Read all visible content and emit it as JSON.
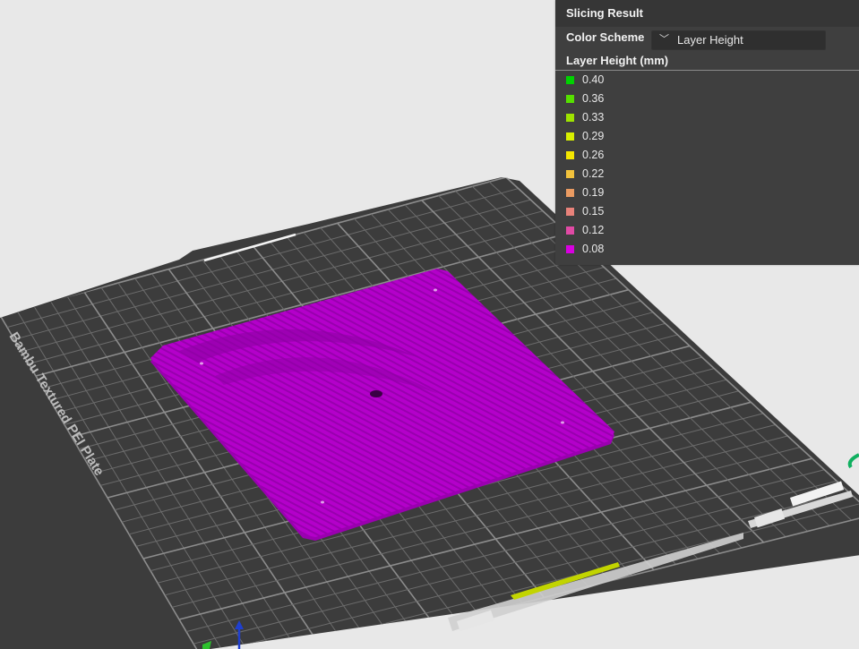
{
  "panel": {
    "title": "Slicing Result",
    "color_scheme_label": "Color Scheme",
    "color_scheme_value": "Layer Height",
    "legend_title": "Layer Height (mm)",
    "legend": [
      {
        "value": "0.40",
        "color": "#00d200"
      },
      {
        "value": "0.36",
        "color": "#56e000"
      },
      {
        "value": "0.33",
        "color": "#9ee300"
      },
      {
        "value": "0.29",
        "color": "#d8ef00"
      },
      {
        "value": "0.26",
        "color": "#f5e700"
      },
      {
        "value": "0.22",
        "color": "#f2c23c"
      },
      {
        "value": "0.19",
        "color": "#ea9b62"
      },
      {
        "value": "0.15",
        "color": "#e8827a"
      },
      {
        "value": "0.12",
        "color": "#e04aa5"
      },
      {
        "value": "0.08",
        "color": "#d800e0"
      }
    ]
  },
  "plate": {
    "label": "Bambu Textured PEI Plate",
    "plate_color": "#3c3c3c",
    "grid_color": "#7a7a7a",
    "model_color": "#b000c6"
  },
  "axis": {
    "z_color": "#1f3fcf",
    "x_color": "#2ec12e"
  }
}
